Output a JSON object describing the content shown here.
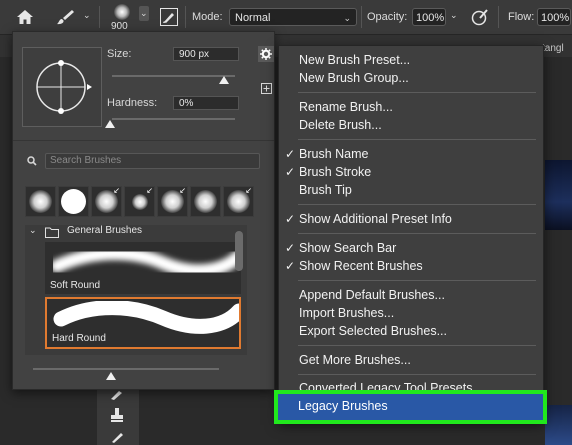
{
  "options_bar": {
    "brush_size_value": "900",
    "mode_label": "Mode:",
    "mode_value": "Normal",
    "opacity_label": "Opacity:",
    "opacity_value": "100%",
    "flow_label": "Flow:",
    "flow_value": "100%",
    "icons": [
      "home-icon",
      "brush-tool-icon",
      "brush-preset-picker-icon",
      "brush-settings-panel-icon",
      "pressure-opacity-icon"
    ]
  },
  "document": {
    "tab_fragment": "tangl"
  },
  "brush_panel": {
    "size_label": "Size:",
    "size_value": "900 px",
    "hardness_label": "Hardness:",
    "hardness_value": "0%",
    "search_placeholder": "Search Brushes",
    "group_name": "General Brushes",
    "brushes": [
      {
        "name": "Soft Round"
      },
      {
        "name": "Hard Round"
      }
    ],
    "size_fraction": 1.0,
    "hardness_fraction": 0.0
  },
  "context_menu": {
    "groups": [
      [
        {
          "label": "New Brush Preset...",
          "checked": false
        },
        {
          "label": "New Brush Group...",
          "checked": false
        }
      ],
      [
        {
          "label": "Rename Brush...",
          "checked": false
        },
        {
          "label": "Delete Brush...",
          "checked": false
        }
      ],
      [
        {
          "label": "Brush Name",
          "checked": true
        },
        {
          "label": "Brush Stroke",
          "checked": true
        },
        {
          "label": "Brush Tip",
          "checked": false
        }
      ],
      [
        {
          "label": "Show Additional Preset Info",
          "checked": true
        }
      ],
      [
        {
          "label": "Show Search Bar",
          "checked": true
        },
        {
          "label": "Show Recent Brushes",
          "checked": true
        }
      ],
      [
        {
          "label": "Append Default Brushes...",
          "checked": false
        },
        {
          "label": "Import Brushes...",
          "checked": false
        },
        {
          "label": "Export Selected Brushes...",
          "checked": false
        }
      ],
      [
        {
          "label": "Get More Brushes...",
          "checked": false
        }
      ],
      [
        {
          "label": "Converted Legacy Tool Presets",
          "checked": false
        },
        {
          "label": "Legacy Brushes",
          "checked": false
        }
      ]
    ],
    "check_glyph": "✓",
    "highlighted_item": "Legacy Brushes"
  },
  "colors": {
    "highlight_border": "#21e81d",
    "highlight_fill": "#2958a6",
    "selected_brush_border": "#e07a30"
  }
}
